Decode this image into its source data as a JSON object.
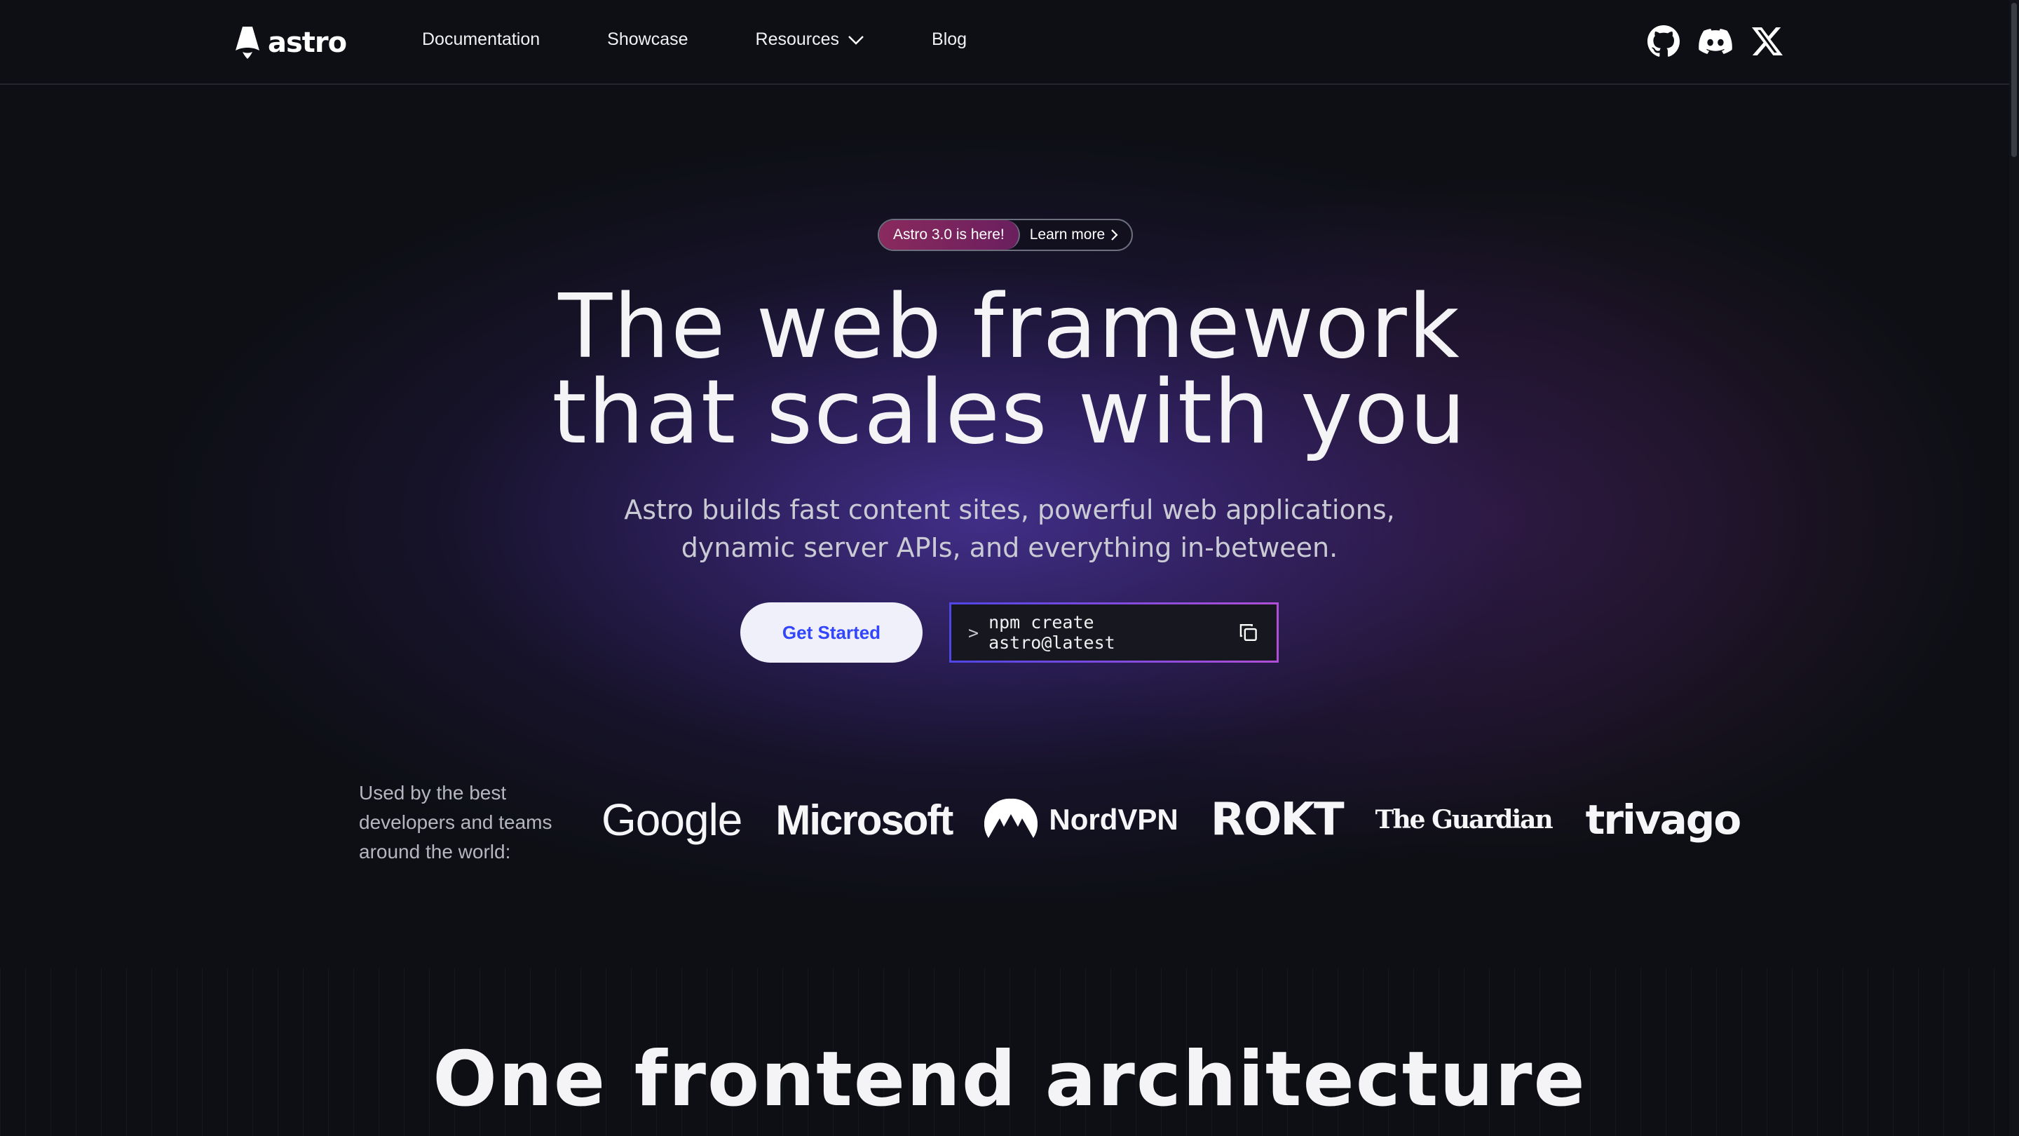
{
  "nav": {
    "logo_text": "astro",
    "links": [
      {
        "label": "Documentation"
      },
      {
        "label": "Showcase"
      },
      {
        "label": "Resources"
      },
      {
        "label": "Blog"
      }
    ],
    "icons": [
      "github-icon",
      "discord-icon",
      "x-icon"
    ]
  },
  "hero": {
    "badge_label": "Astro 3.0 is here!",
    "badge_link": "Learn more",
    "headline_line1": "The web framework",
    "headline_line2": "that scales with you",
    "subhead_line1": "Astro builds fast content sites, powerful web applications,",
    "subhead_line2": "dynamic server APIs, and everything in-between.",
    "cta_primary": "Get Started",
    "command_prompt": ">",
    "command": "npm create astro@latest"
  },
  "logos": {
    "intro": "Used by the best developers and teams around the world:",
    "brands": [
      "Google",
      "Microsoft",
      "NordVPN",
      "ROKT",
      "The Guardian",
      "trivago"
    ]
  },
  "section": {
    "title_line1": "One frontend architecture"
  },
  "colors": {
    "background": "#0d0f14",
    "accent": "#3245ff",
    "badge": "#8a2a5e",
    "glow": "#4a349c"
  }
}
